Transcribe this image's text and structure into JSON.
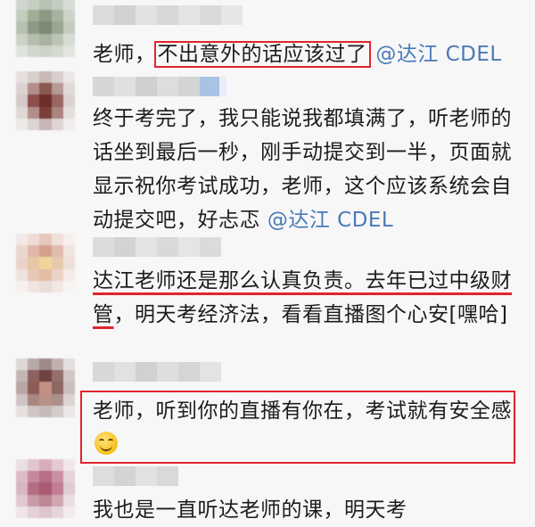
{
  "comments": [
    {
      "text_before": "老师，",
      "text_boxed": "不出意外的话应该过了",
      "mention": "@达江 CDEL"
    },
    {
      "text": "终于考完了，我只能说我都填满了，听老师的话坐到最后一秒，刚手动提交到一半，页面就显示祝你考试成功，老师，这个应该系统会自动提交吧，好忐忑",
      "mention": "@达江 CDEL"
    },
    {
      "text_underlined": "达江老师还是那么认真负责。去年已过中级财管",
      "text_after": "，明天考经济法，看看直播图个心安[嘿哈]"
    },
    {
      "text": "老师，听到你的直播有你在，考试就有安全感",
      "emoji": "smile-emoji"
    },
    {
      "text": "我也是一直听达老师的课，明天考"
    }
  ],
  "highlight_color": "#e0242e",
  "mention_color": "#4a79b9"
}
